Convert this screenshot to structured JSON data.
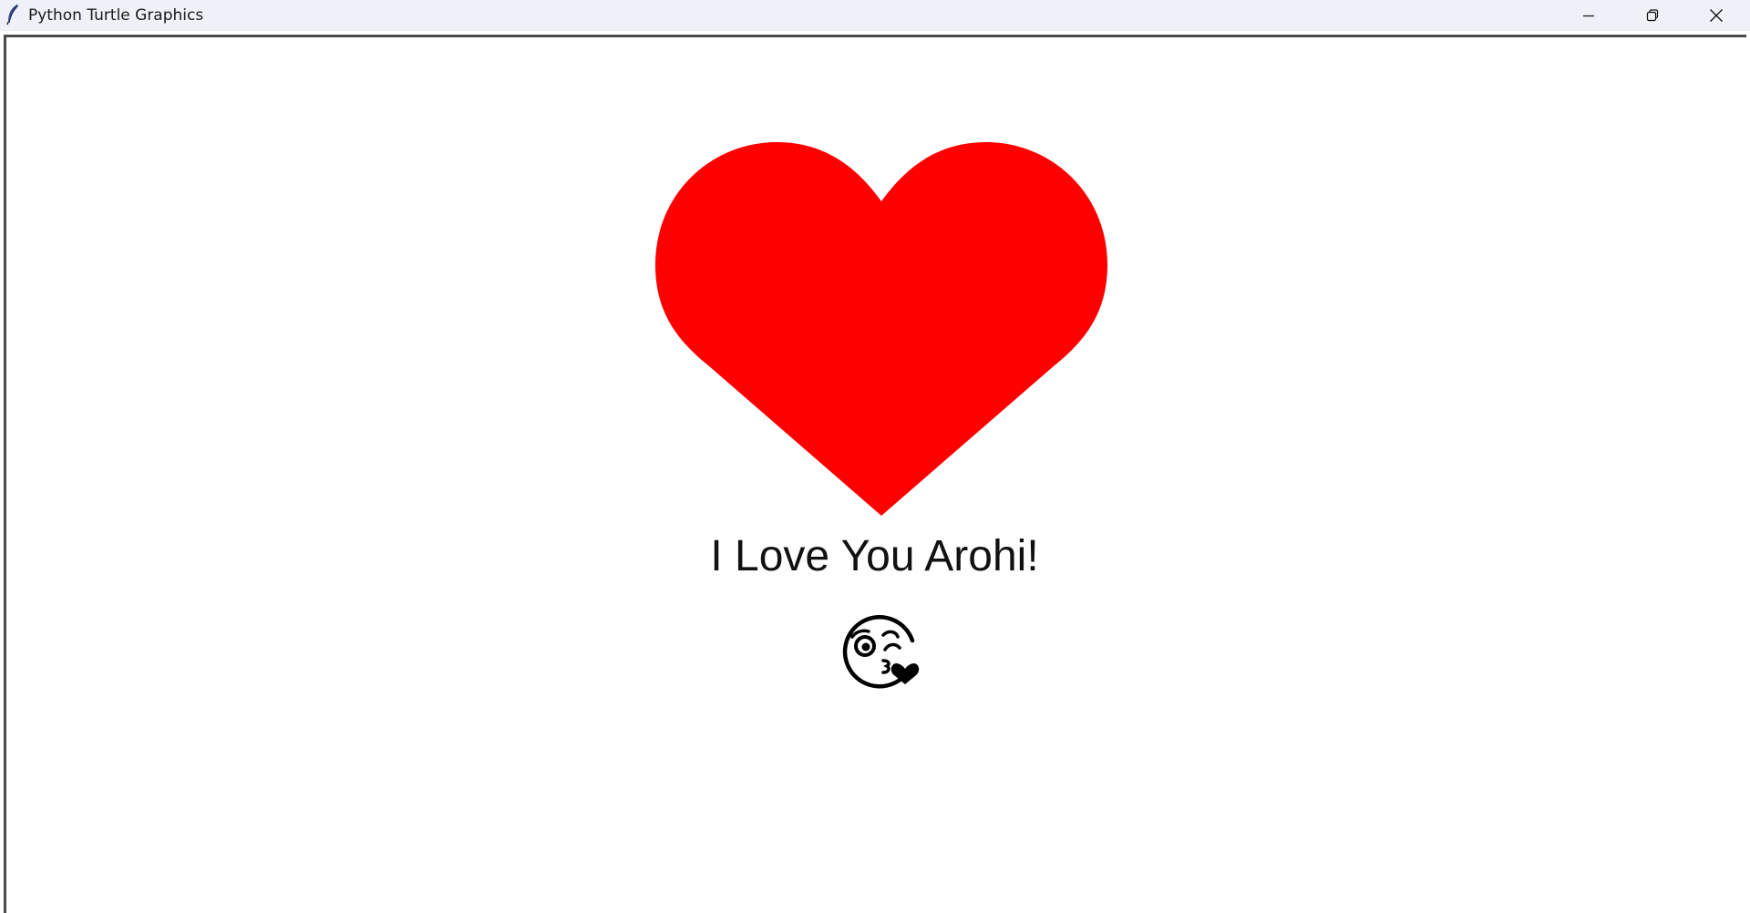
{
  "window": {
    "title": "Python Turtle Graphics",
    "app_icon": "tk-feather-icon",
    "controls": {
      "minimize_icon": "minimize-icon",
      "maximize_icon": "restore-icon",
      "close_icon": "close-icon"
    }
  },
  "canvas": {
    "background": "#ffffff",
    "heart": {
      "icon": "heart-shape",
      "fill_color": "#ff0000"
    },
    "message": "I Love You Arohi!",
    "emoji": {
      "icon": "face-blowing-kiss-emoji",
      "glyph": "😘"
    }
  }
}
